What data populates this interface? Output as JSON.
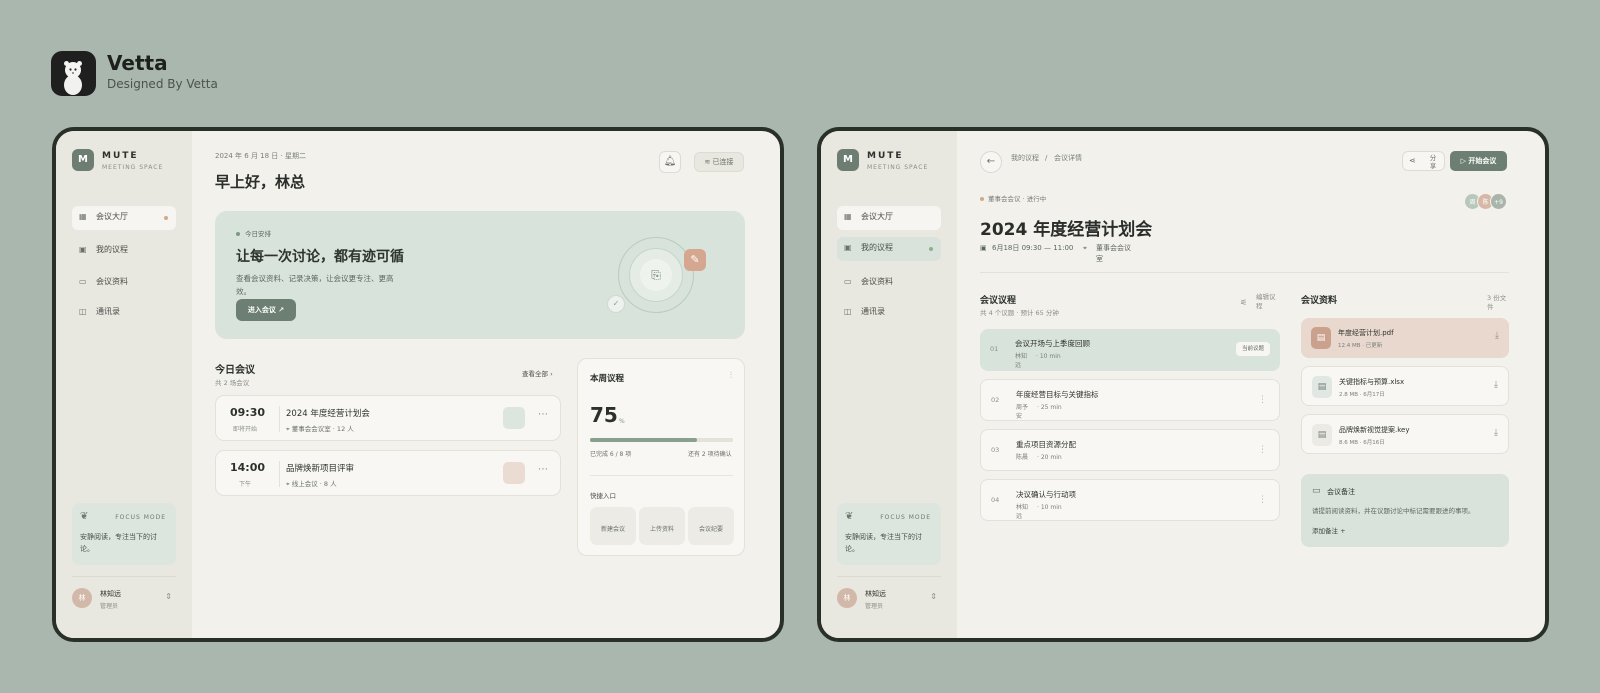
{
  "brand": {
    "name": "Vetta",
    "subtitle": "Designed By Vetta",
    "icon": "weasel-logo"
  },
  "colors": {
    "background": "#a9b7ae",
    "accent_green": "#6d7f72",
    "accent_peach": "#d5a690",
    "surface": "#f2f1ec"
  },
  "sidebar": {
    "logo_letter": "M",
    "app_name": "MUTE",
    "app_sub": "MEETING SPACE",
    "focus_title": "FOCUS MODE",
    "focus_desc": "安静阅读，专注当下的讨论。",
    "user_name": "林知远",
    "user_role": "管理员",
    "user_initial": "林"
  },
  "screen1": {
    "nav": [
      {
        "label": "会议大厅",
        "icon": "grid-icon"
      },
      {
        "label": "我的议程",
        "icon": "calendar-icon"
      },
      {
        "label": "会议资料",
        "icon": "folder-icon"
      },
      {
        "label": "通讯录",
        "icon": "contacts-icon"
      }
    ],
    "date": "2024 年 6 月 18 日 · 星期二",
    "greeting": "早上好，林总",
    "connection": "已连接",
    "hero": {
      "tag": "今日安排",
      "title": "让每一次讨论，都有迹可循",
      "desc": "查看会议资料、记录决策，让会议更专注、更高效。",
      "button": "进入会议 ↗"
    },
    "today": {
      "title": "今日会议",
      "count": "共 2 场会议",
      "view_all": "查看全部 ›",
      "meetings": [
        {
          "time": "09:30",
          "status": "即将开始",
          "title": "2024 年度经营计划会",
          "location": "董事会会议室 · 12 人",
          "color": "#dce6de"
        },
        {
          "time": "14:00",
          "status": "下午",
          "title": "品牌焕新项目评审",
          "location": "线上会议 · 8 人",
          "color": "#eadcd2"
        }
      ]
    },
    "weekly": {
      "title": "本周议程",
      "percent": "75",
      "unit": "%",
      "progress": 0.75,
      "done": "已完成 6 / 8 项",
      "remaining": "还有 2 项待确认",
      "quick_title": "快捷入口",
      "quick": [
        "新建会议",
        "上传资料",
        "会议纪要"
      ]
    }
  },
  "screen2": {
    "nav": [
      {
        "label": "会议大厅",
        "icon": "grid-icon"
      },
      {
        "label": "我的议程",
        "icon": "calendar-icon"
      },
      {
        "label": "会议资料",
        "icon": "folder-icon"
      },
      {
        "label": "通讯录",
        "icon": "contacts-icon"
      }
    ],
    "breadcrumb": [
      "我的议程",
      "/",
      "会议详情"
    ],
    "share": "分享",
    "start": "▷ 开始会议",
    "status_tag": "董事会会议 · 进行中",
    "title": "2024 年度经营计划会",
    "time": "6月18日 09:30 — 11:00",
    "location": "董事会会议室",
    "avatars": [
      {
        "t": "周",
        "c": "#b7c8bb"
      },
      {
        "t": "陈",
        "c": "#d7b8a8"
      },
      {
        "t": "+9",
        "c": "#a9b5ab"
      }
    ],
    "agenda": {
      "title": "会议议程",
      "sub": "共 4 个议题 · 预计 65 分钟",
      "edit": "编辑议程",
      "current": "当前议题",
      "items": [
        {
          "n": "01",
          "t": "会议开场与上季度回顾",
          "p": "林知远",
          "m": "10 min"
        },
        {
          "n": "02",
          "t": "年度经营目标与关键指标",
          "p": "周予安",
          "m": "25 min"
        },
        {
          "n": "03",
          "t": "重点项目资源分配",
          "p": "陈晨",
          "m": "20 min"
        },
        {
          "n": "04",
          "t": "决议确认与行动项",
          "p": "林知远",
          "m": "10 min"
        }
      ]
    },
    "files": {
      "title": "会议资料",
      "count": "3 份文件",
      "items": [
        {
          "n": "年度经营计划.pdf",
          "m": "12.4 MB · 已更新"
        },
        {
          "n": "关键指标与预算.xlsx",
          "m": "2.8 MB · 6月17日"
        },
        {
          "n": "品牌焕新视觉提案.key",
          "m": "8.6 MB · 6月16日"
        }
      ]
    },
    "note": {
      "title": "会议备注",
      "desc": "请提前阅读资料，并在议题讨论中标记需要跟进的事项。",
      "add": "添加备注 +"
    }
  }
}
